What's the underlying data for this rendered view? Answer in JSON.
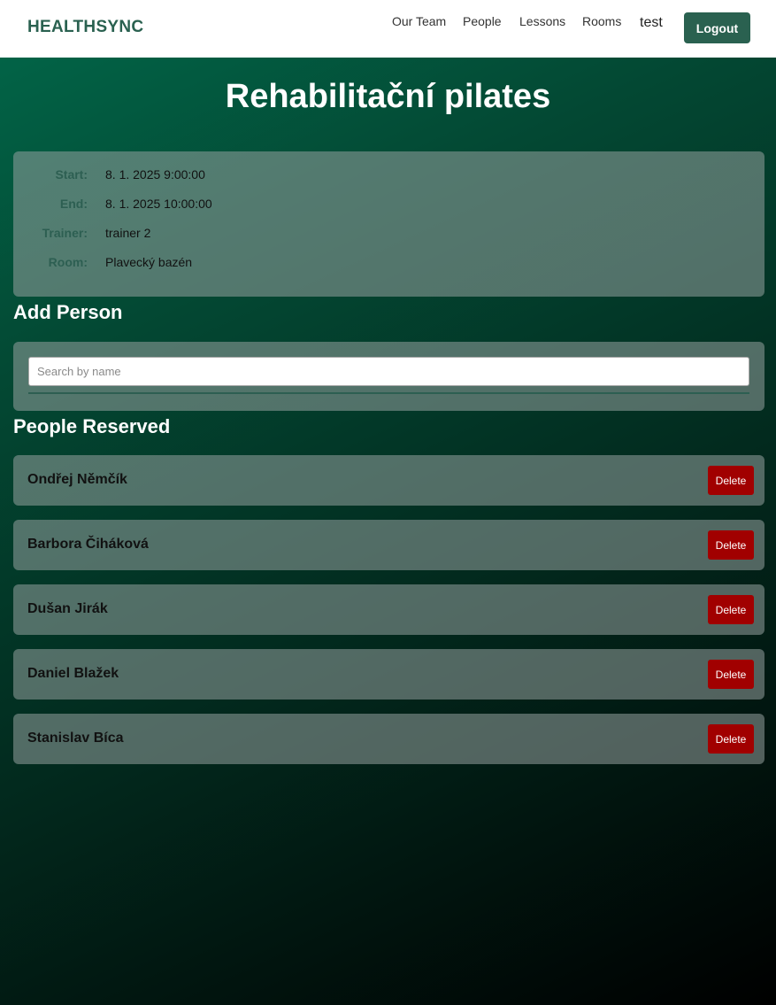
{
  "navbar": {
    "brand": "HEALTHSYNC",
    "links": [
      {
        "label": "Our Team"
      },
      {
        "label": "People"
      },
      {
        "label": "Lessons"
      },
      {
        "label": "Rooms"
      }
    ],
    "user": "test",
    "logout_label": "Logout"
  },
  "lesson": {
    "title": "Rehabilitační pilates",
    "details": [
      {
        "label": "Start:",
        "value": "8. 1. 2025 9:00:00"
      },
      {
        "label": "End:",
        "value": "8. 1. 2025 10:00:00"
      },
      {
        "label": "Trainer:",
        "value": "trainer 2"
      },
      {
        "label": "Room:",
        "value": "Plavecký bazén"
      }
    ]
  },
  "add_person": {
    "heading": "Add Person",
    "search_placeholder": "Search by name",
    "search_value": ""
  },
  "reserved": {
    "heading": "People Reserved",
    "delete_label": "Delete",
    "people": [
      {
        "name": "Ondřej Němčík"
      },
      {
        "name": "Barbora Čiháková"
      },
      {
        "name": "Dušan Jirák"
      },
      {
        "name": "Daniel Blažek"
      },
      {
        "name": "Stanislav Bíca"
      }
    ]
  },
  "colors": {
    "brand": "#2a6150",
    "delete": "#a10000",
    "background_start": "#02684a",
    "background_end": "#000000"
  }
}
